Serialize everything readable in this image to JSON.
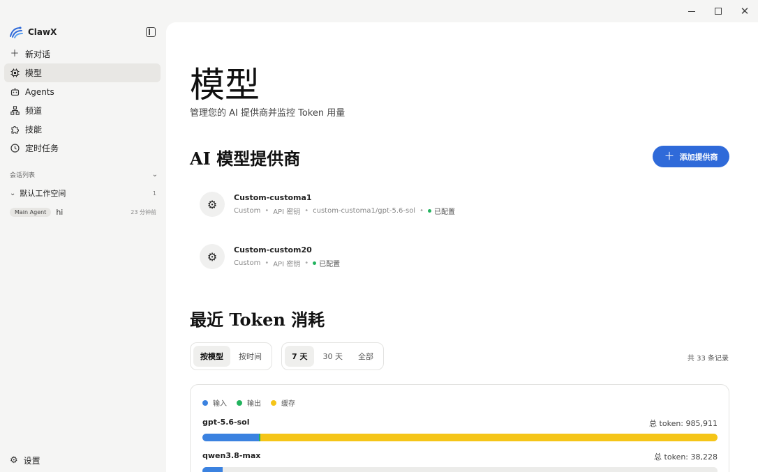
{
  "window": {
    "controls": [
      "minimize",
      "maximize",
      "close"
    ]
  },
  "app": {
    "name": "ClawX"
  },
  "sidebar": {
    "items": [
      {
        "label": "新对话",
        "icon": "plus-icon",
        "active": false
      },
      {
        "label": "模型",
        "icon": "cpu-icon",
        "active": true
      },
      {
        "label": "Agents",
        "icon": "robot-icon",
        "active": false
      },
      {
        "label": "频道",
        "icon": "network-icon",
        "active": false
      },
      {
        "label": "技能",
        "icon": "puzzle-icon",
        "active": false
      },
      {
        "label": "定时任务",
        "icon": "clock-icon",
        "active": false
      }
    ],
    "sessions_label": "会话列表",
    "workspace": {
      "name": "默认工作空间",
      "count": "1"
    },
    "chat": {
      "agent": "Main Agent",
      "title": "hi",
      "time": "23 分钟前"
    },
    "settings_label": "设置"
  },
  "main": {
    "title": "模型",
    "subtitle": "管理您的 AI 提供商并监控 Token 用量",
    "providers_title": "AI 模型提供商",
    "add_provider": "添加提供商",
    "providers": [
      {
        "name": "Custom-customa1",
        "type": "Custom",
        "auth": "API 密钥",
        "model": "custom-customa1/gpt-5.6-sol",
        "status": "已配置"
      },
      {
        "name": "Custom-custom20",
        "type": "Custom",
        "auth": "API 密钥",
        "model": "",
        "status": "已配置"
      }
    ],
    "usage_title": "最近 Token 消耗",
    "group_tabs": [
      {
        "label": "按模型",
        "active": true
      },
      {
        "label": "按时间",
        "active": false
      }
    ],
    "range_tabs": [
      {
        "label": "7 天",
        "active": true
      },
      {
        "label": "30 天",
        "active": false
      },
      {
        "label": "全部",
        "active": false
      }
    ],
    "record_count": "共 33 条记录",
    "legend": [
      {
        "label": "输入",
        "color": "#3b82e0"
      },
      {
        "label": "输出",
        "color": "#22b35e"
      },
      {
        "label": "缓存",
        "color": "#f5c518"
      }
    ],
    "usage_rows": [
      {
        "model": "gpt-5.6-sol",
        "total": "总 token: 985,911",
        "input_fraction": 0.11,
        "output_fraction": 0.003,
        "cache_fraction": 0.887,
        "scale": 1.0
      },
      {
        "model": "qwen3.8-max",
        "total": "总 token: 38,228",
        "input_fraction": 1.0,
        "output_fraction": 0.0,
        "cache_fraction": 0.0,
        "scale": 0.0388
      }
    ]
  }
}
